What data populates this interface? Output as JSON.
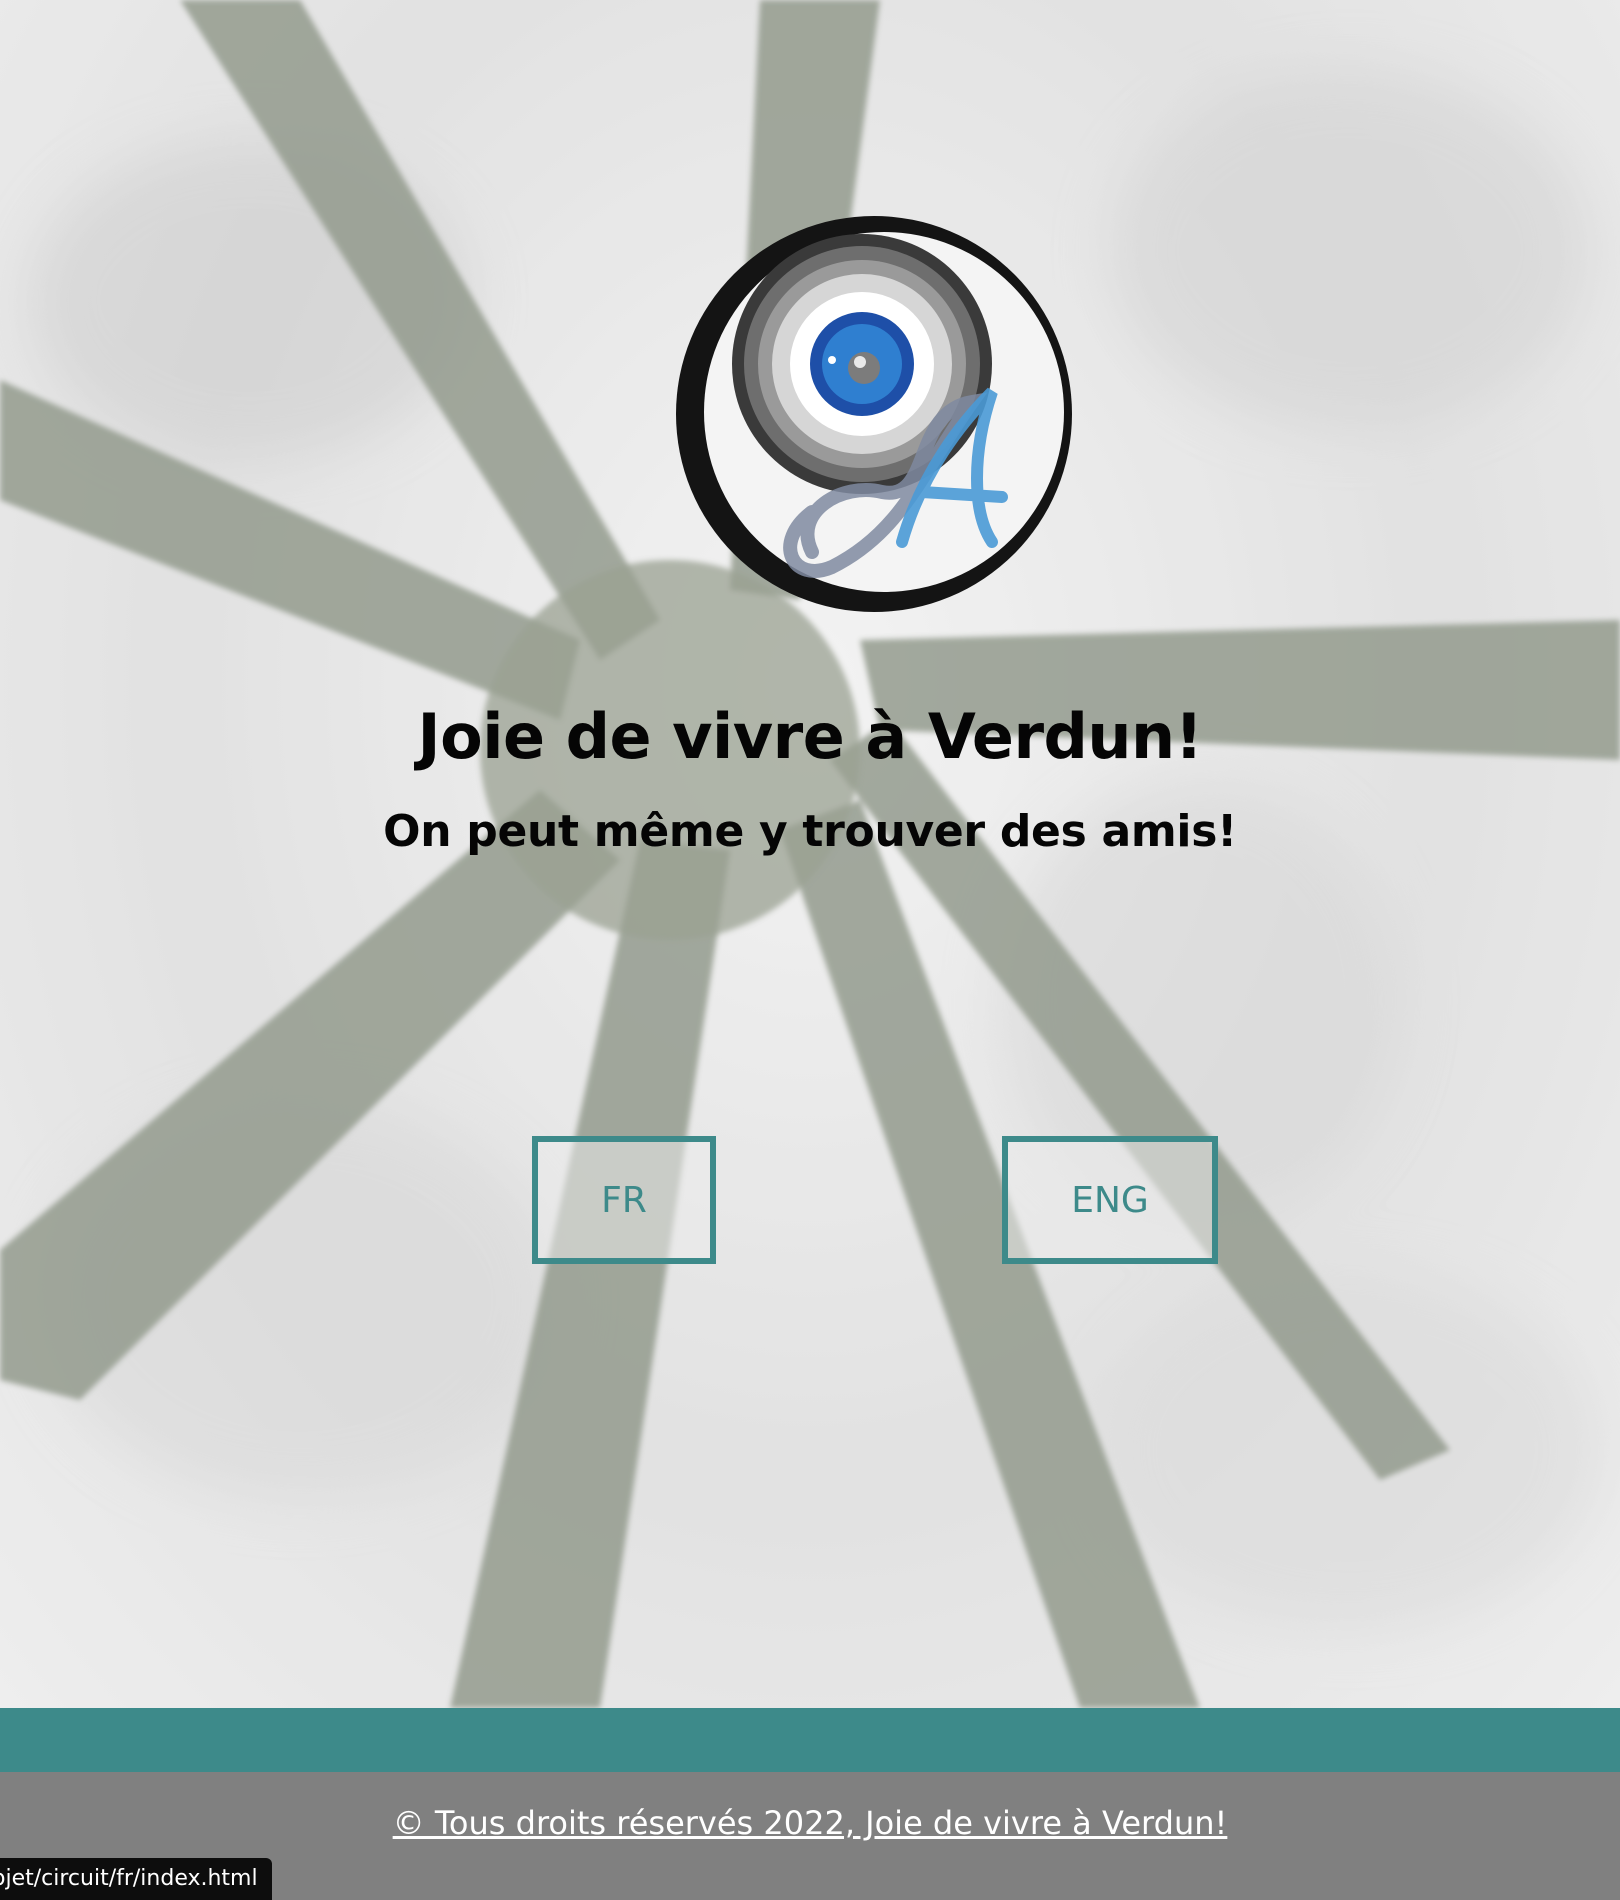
{
  "hero": {
    "title": "Joie de vivre à Verdun!",
    "subtitle": "On peut même y trouver des amis!"
  },
  "language_buttons": {
    "fr_label": "FR",
    "eng_label": "ENG"
  },
  "footer": {
    "copyright": "© Tous droits réservés 2022, Joie de vivre à Verdun!"
  },
  "status_bar": {
    "url": "ojet/circuit/fr/index.html"
  },
  "colors": {
    "accent_teal": "#3d8a8a",
    "footer_gray": "#808080",
    "logo_blue": "#2f7fd0"
  },
  "icons": {
    "logo": "camera-lens-monogram-logo"
  }
}
